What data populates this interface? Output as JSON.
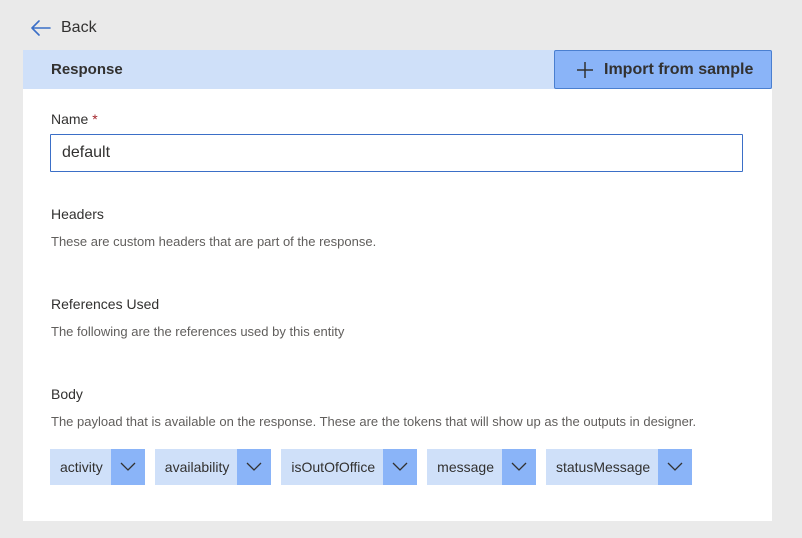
{
  "nav": {
    "back_label": "Back"
  },
  "response": {
    "title": "Response",
    "import_label": "Import from sample"
  },
  "name_field": {
    "label": "Name",
    "required_mark": "*",
    "value": "default"
  },
  "headers_section": {
    "label": "Headers",
    "description": "These are custom headers that are part of the response."
  },
  "references_section": {
    "label": "References Used",
    "description": "The following are the references used by this entity"
  },
  "body_section": {
    "label": "Body",
    "description": "The payload that is available on the response. These are the tokens that will show up as the outputs in designer.",
    "tokens": [
      {
        "label": "activity"
      },
      {
        "label": "availability"
      },
      {
        "label": "isOutOfOffice"
      },
      {
        "label": "message"
      },
      {
        "label": "statusMessage"
      }
    ]
  },
  "icons": {
    "back": "back-arrow-icon",
    "import": "plus-icon",
    "token_caret": "chevron-down-icon"
  },
  "colors": {
    "accent": "#3b6fc7",
    "header_bg": "#cfe0f9",
    "button_bg": "#8ab4f8",
    "page_bg": "#eaeaea"
  }
}
